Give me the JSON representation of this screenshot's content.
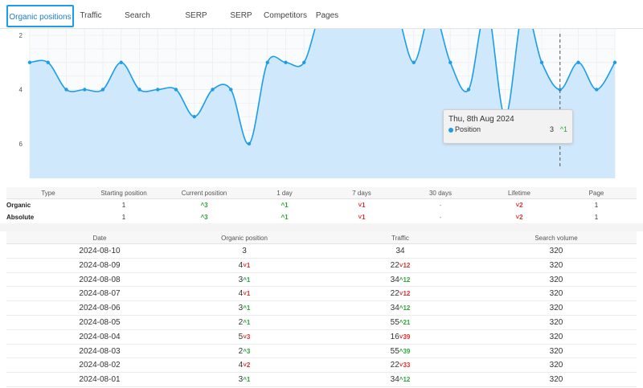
{
  "tabs": [
    {
      "label": "Organic positions",
      "active": true
    },
    {
      "label": "Traffic",
      "active": false
    },
    {
      "label": "Search volume",
      "active": false
    },
    {
      "label": "SERP features",
      "active": false
    },
    {
      "label": "SERP",
      "active": false
    },
    {
      "label": "Competitors",
      "active": false
    },
    {
      "label": "Pages",
      "active": false
    }
  ],
  "chart_data": {
    "type": "area",
    "y_axis": {
      "ticks": [
        "2",
        "4",
        "6"
      ],
      "reversed": true,
      "range": [
        1.0,
        6.3
      ]
    },
    "series": [
      {
        "values": [
          3,
          3,
          4,
          4,
          4,
          3,
          4,
          4,
          4,
          5,
          4,
          4,
          6,
          3,
          3,
          3,
          1,
          1,
          1,
          1,
          1,
          3,
          1,
          3,
          4,
          1,
          5,
          1,
          3,
          4,
          3,
          4,
          3
        ]
      }
    ],
    "colors": {
      "line": "#1b9de9",
      "fill": "#cde7fb"
    },
    "grid": true,
    "hover_marker": {
      "date": "Thu, 8th Aug 2024",
      "label": "Position",
      "value": "3",
      "delta": "1",
      "delta_dir": "up"
    }
  },
  "summary": {
    "headers": [
      "Type",
      "Starting position",
      "Current position",
      "1 day",
      "7 days",
      "30 days",
      "Lifetime",
      "Page"
    ],
    "rows": [
      {
        "type": "Organic",
        "start": "1",
        "current": {
          "arrow": "^",
          "val": "3",
          "dir": "up"
        },
        "d1": {
          "arrow": "^",
          "val": "1",
          "dir": "up"
        },
        "d7": {
          "arrow": "˅",
          "val": "1",
          "dir": "down"
        },
        "d30": "-",
        "lifetime": {
          "arrow": "˅",
          "val": "2",
          "dir": "down"
        },
        "page": "1"
      },
      {
        "type": "Absolute",
        "start": "1",
        "current": {
          "arrow": "^",
          "val": "3",
          "dir": "up"
        },
        "d1": {
          "arrow": "^",
          "val": "1",
          "dir": "up"
        },
        "d7": {
          "arrow": "˅",
          "val": "1",
          "dir": "down"
        },
        "d30": "-",
        "lifetime": {
          "arrow": "˅",
          "val": "2",
          "dir": "down"
        },
        "page": "1"
      }
    ]
  },
  "history": {
    "headers": [
      "Date",
      "Organic position",
      "Traffic",
      "Search volume"
    ],
    "rows": [
      {
        "date": "2024-08-10",
        "pos": "3",
        "pos_dir": "",
        "pos_delta": "",
        "traffic": "34",
        "traffic_dir": "",
        "traffic_delta": "",
        "volume": "320"
      },
      {
        "date": "2024-08-09",
        "pos": "4",
        "pos_dir": "down",
        "pos_delta": "1",
        "traffic": "22",
        "traffic_dir": "down",
        "traffic_delta": "12",
        "volume": "320"
      },
      {
        "date": "2024-08-08",
        "pos": "3",
        "pos_dir": "up",
        "pos_delta": "1",
        "traffic": "34",
        "traffic_dir": "up",
        "traffic_delta": "12",
        "volume": "320"
      },
      {
        "date": "2024-08-07",
        "pos": "4",
        "pos_dir": "down",
        "pos_delta": "1",
        "traffic": "22",
        "traffic_dir": "down",
        "traffic_delta": "12",
        "volume": "320"
      },
      {
        "date": "2024-08-06",
        "pos": "3",
        "pos_dir": "up",
        "pos_delta": "1",
        "traffic": "34",
        "traffic_dir": "up",
        "traffic_delta": "12",
        "volume": "320"
      },
      {
        "date": "2024-08-05",
        "pos": "2",
        "pos_dir": "up",
        "pos_delta": "1",
        "traffic": "55",
        "traffic_dir": "up",
        "traffic_delta": "21",
        "volume": "320"
      },
      {
        "date": "2024-08-04",
        "pos": "5",
        "pos_dir": "down",
        "pos_delta": "3",
        "traffic": "16",
        "traffic_dir": "down",
        "traffic_delta": "39",
        "volume": "320"
      },
      {
        "date": "2024-08-03",
        "pos": "2",
        "pos_dir": "up",
        "pos_delta": "3",
        "traffic": "55",
        "traffic_dir": "up",
        "traffic_delta": "39",
        "volume": "320"
      },
      {
        "date": "2024-08-02",
        "pos": "4",
        "pos_dir": "down",
        "pos_delta": "2",
        "traffic": "22",
        "traffic_dir": "down",
        "traffic_delta": "33",
        "volume": "320"
      },
      {
        "date": "2024-08-01",
        "pos": "3",
        "pos_dir": "up",
        "pos_delta": "1",
        "traffic": "34",
        "traffic_dir": "up",
        "traffic_delta": "12",
        "volume": "320"
      }
    ]
  },
  "arrows": {
    "up": "^",
    "down": "˅"
  }
}
